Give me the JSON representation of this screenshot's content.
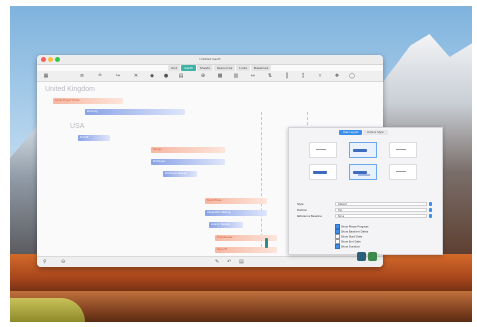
{
  "window": {
    "title": "Untitled Gantt"
  },
  "tabs": [
    {
      "label": "Grid",
      "active": false
    },
    {
      "label": "Gantt",
      "active": true
    },
    {
      "label": "Sheets",
      "active": false
    },
    {
      "label": "Resources",
      "active": false
    },
    {
      "label": "Links",
      "active": false
    },
    {
      "label": "Baselines",
      "active": false
    }
  ],
  "groups": {
    "uk": "United Kingdom",
    "usa": "USA"
  },
  "rows": {
    "uk_1": "Some Project Phase",
    "uk_2": "Planning",
    "usa_1": "Kickoff",
    "usa_2": "Design",
    "usa_3": "Prototype",
    "usa_4": "Prototype Review",
    "usa_5": "Build Phase",
    "usa_6": "Integration Testing",
    "usa_7": "Launch Review",
    "usa_8": "Final Review",
    "usa_9": "Sign-off"
  },
  "inspector": {
    "tabs": [
      "Task Layout",
      "Date & Style"
    ],
    "fields": [
      {
        "label": "Style",
        "value": "Default"
      },
      {
        "label": "Position",
        "value": "Top"
      },
      {
        "label": "Reference Baseline",
        "value": "None"
      }
    ],
    "options": [
      {
        "label": "Show Phase Progress",
        "checked": true
      },
      {
        "label": "Show Baseline Dates",
        "checked": true
      },
      {
        "label": "Show Start Date",
        "checked": false
      },
      {
        "label": "Show End Date",
        "checked": false
      },
      {
        "label": "Show Duration",
        "checked": true
      }
    ]
  },
  "colors": {
    "accent": "#3fb4a6",
    "task_bar": "#f6b7a2",
    "milestone_bar": "#8aa3e6"
  }
}
